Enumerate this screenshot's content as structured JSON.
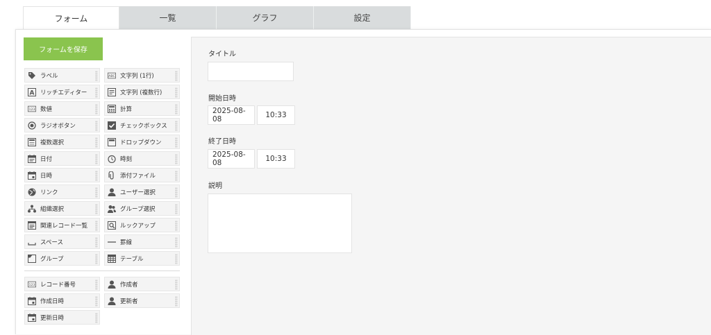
{
  "tabs": [
    {
      "label": "フォーム",
      "active": true
    },
    {
      "label": "一覧",
      "active": false
    },
    {
      "label": "グラフ",
      "active": false
    },
    {
      "label": "設定",
      "active": false
    }
  ],
  "save_button": "フォームを保存",
  "palette": [
    {
      "label": "ラベル",
      "icon": "tag-icon"
    },
    {
      "label": "文字列 (1行)",
      "icon": "abc-text-icon"
    },
    {
      "label": "リッチエディター",
      "icon": "rich-editor-icon"
    },
    {
      "label": "文字列 (複数行)",
      "icon": "multiline-text-icon"
    },
    {
      "label": "数値",
      "icon": "number-icon"
    },
    {
      "label": "計算",
      "icon": "calculator-icon"
    },
    {
      "label": "ラジオボタン",
      "icon": "radio-icon"
    },
    {
      "label": "チェックボックス",
      "icon": "checkbox-icon"
    },
    {
      "label": "複数選択",
      "icon": "multi-select-icon"
    },
    {
      "label": "ドロップダウン",
      "icon": "dropdown-icon"
    },
    {
      "label": "日付",
      "icon": "date-icon"
    },
    {
      "label": "時刻",
      "icon": "clock-icon"
    },
    {
      "label": "日時",
      "icon": "datetime-icon"
    },
    {
      "label": "添付ファイル",
      "icon": "paperclip-icon"
    },
    {
      "label": "リンク",
      "icon": "globe-icon"
    },
    {
      "label": "ユーザー選択",
      "icon": "user-icon"
    },
    {
      "label": "組織選択",
      "icon": "org-icon"
    },
    {
      "label": "グループ選択",
      "icon": "group-icon"
    },
    {
      "label": "関連レコード一覧",
      "icon": "related-records-icon"
    },
    {
      "label": "ルックアップ",
      "icon": "lookup-icon"
    },
    {
      "label": "スペース",
      "icon": "space-icon"
    },
    {
      "label": "罫線",
      "icon": "line-icon"
    },
    {
      "label": "グループ",
      "icon": "group-folder-icon"
    },
    {
      "label": "テーブル",
      "icon": "table-icon"
    }
  ],
  "system_fields": [
    {
      "label": "レコード番号",
      "icon": "number-icon"
    },
    {
      "label": "作成者",
      "icon": "user-icon"
    },
    {
      "label": "作成日時",
      "icon": "datetime-icon"
    },
    {
      "label": "更新者",
      "icon": "user-icon"
    },
    {
      "label": "更新日時",
      "icon": "datetime-icon"
    }
  ],
  "form": {
    "title_label": "タイトル",
    "title_value": "",
    "start_label": "開始日時",
    "start_date": "2025-08-08",
    "start_time": "10:33",
    "end_label": "終了日時",
    "end_date": "2025-08-08",
    "end_time": "10:33",
    "desc_label": "説明",
    "desc_value": ""
  },
  "colors": {
    "accent": "#8ac44e",
    "tab_bg": "#d9dcdd",
    "canvas_bg": "#f5f5f5"
  }
}
